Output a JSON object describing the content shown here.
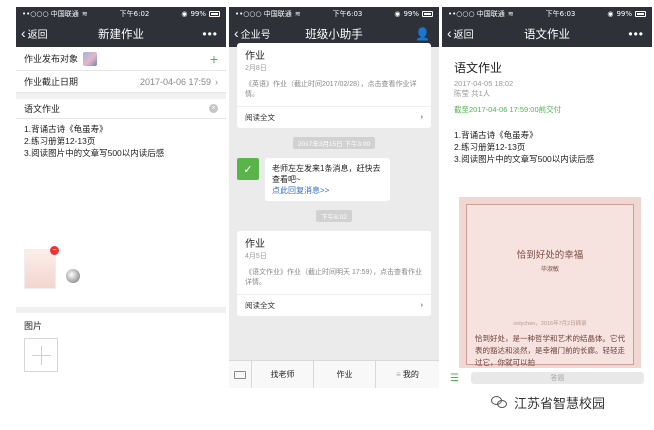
{
  "status": {
    "carrier": "••○○○ 中国联通",
    "wifi": "WiFi",
    "times": [
      "下午6:02",
      "下午6:03",
      "下午6:03"
    ],
    "battery": "99%"
  },
  "screen1": {
    "nav": {
      "back": "返回",
      "title": "新建作业",
      "more": "•••"
    },
    "target_label": "作业发布对象",
    "deadline_label": "作业截止日期",
    "deadline_value": "2017-04-06 17:59",
    "subject": "语文作业",
    "lines": [
      "1.背诵古诗《龟虽寿》",
      "2.练习册第12-13页",
      "3.阅读图片中的文章写500以内读后感"
    ],
    "images_label": "图片"
  },
  "screen2": {
    "nav": {
      "back": "企业号",
      "title": "班级小助手"
    },
    "card1": {
      "title": "作业",
      "date": "2月8日",
      "desc": "《英语》作业（截止时间2017/02/28），点击查看作业详情。",
      "more": "阅读全文"
    },
    "time1": "2017年3月15日 下午3:00",
    "msg_text": "老师左左发来1条消息，赶快去查看吧~",
    "msg_link": "点此回复消息>>",
    "time2": "下午6:02",
    "card2": {
      "title": "作业",
      "date": "4月5日",
      "desc": "《语文作业》作业（截止时间明天 17:59），点击查看作业详情。",
      "more": "阅读全文"
    },
    "tabs": [
      "找老师",
      "作业",
      "我的"
    ]
  },
  "screen3": {
    "nav": {
      "back": "返回",
      "title": "语文作业",
      "more": "•••"
    },
    "title": "语文作业",
    "date": "2017-04-05 18:02",
    "author": "陈莹 共1人",
    "due": "截至2017-04-06 17:59:00前交付",
    "lines": [
      "1.背诵古诗《龟虽寿》",
      "2.练习册第12-13页",
      "3.阅读图片中的文章写500以内读后感"
    ],
    "doc": {
      "title": "恰到好处的幸福",
      "author": "毕淑敏",
      "meta": "onlychen，2016年7月2日摘录",
      "body": "恰到好处，是一种哲学和艺术的结晶体。它代表的豁达和淡然，是幸福门前的长廊。轻轻走过它，你就可以拍"
    },
    "answer_label": "答题"
  },
  "watermark": "江苏省智慧校园"
}
